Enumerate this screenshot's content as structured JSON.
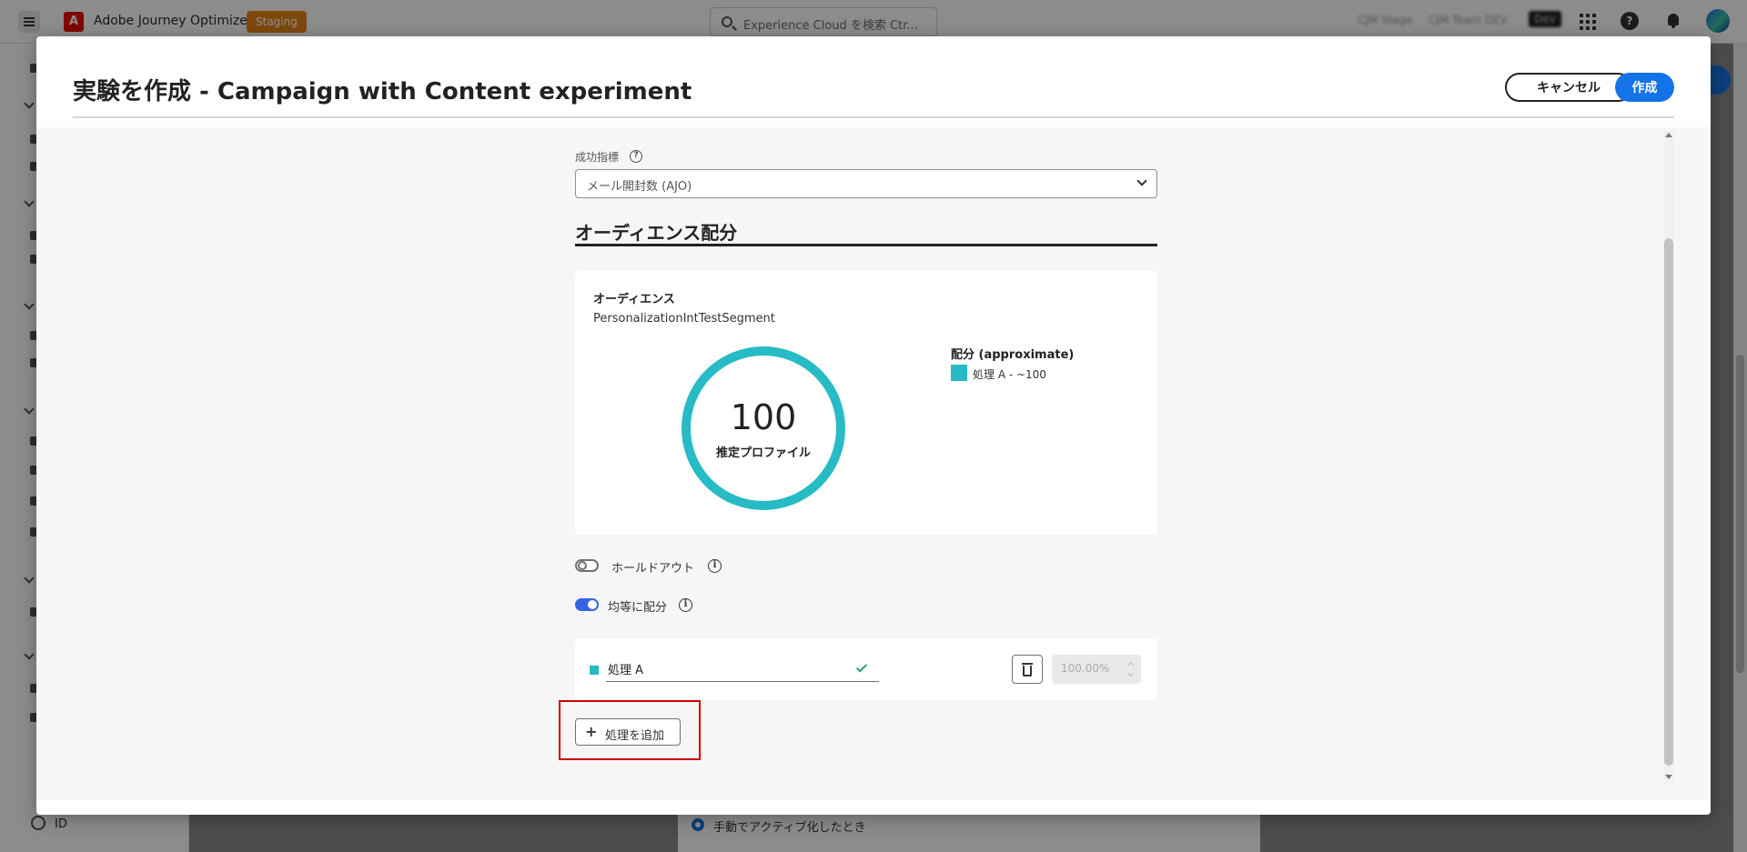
{
  "app": {
    "name": "Adobe Journey Optimizer",
    "logo_letter": "A",
    "env_badge": "Staging",
    "search_placeholder": "Experience Cloud を検索 Ctr...",
    "org_items": [
      "CJM Stage",
      "CJM Team DEV",
      "Dev"
    ],
    "help_glyph": "?",
    "icons": [
      "menu-icon",
      "apps-icon",
      "help-icon",
      "notifications-icon",
      "avatar"
    ]
  },
  "background": {
    "nav_bottom_label": "ID",
    "radio_label": "手動でアクティブ化したとき"
  },
  "modal": {
    "title": "実験を作成 - Campaign with Content experiment",
    "cancel_label": "キャンセル",
    "create_label": "作成",
    "success_metric": {
      "label": "成功指標",
      "help_glyph": "?",
      "value": "メール開封数 (AJO)"
    },
    "audience_section": {
      "heading": "オーディエンス配分",
      "audience_label": "オーディエンス",
      "audience_name": "PersonalizationIntTestSegment",
      "estimated_profiles": "100",
      "estimated_profiles_label": "推定プロファイル",
      "legend_title": "配分 (approximate)",
      "legend_items": [
        {
          "label": "処理 A - ~100",
          "color": "#26bbc5"
        }
      ]
    },
    "holdout": {
      "label": "ホールドアウト",
      "enabled": false
    },
    "distribute_evenly": {
      "label": "均等に配分",
      "enabled": true
    },
    "info_glyph": "i",
    "treatments": [
      {
        "name": "処理 A",
        "percentage": "100.00%",
        "color": "#26bbc5",
        "valid": true
      }
    ],
    "add_treatment_label": "処理を追加",
    "add_glyph": "+"
  },
  "colors": {
    "accent": "#1473e6",
    "treatment": "#26bbc5",
    "toggle_on": "#3562e3",
    "highlight": "#cc0000",
    "staging": "#e68619"
  }
}
